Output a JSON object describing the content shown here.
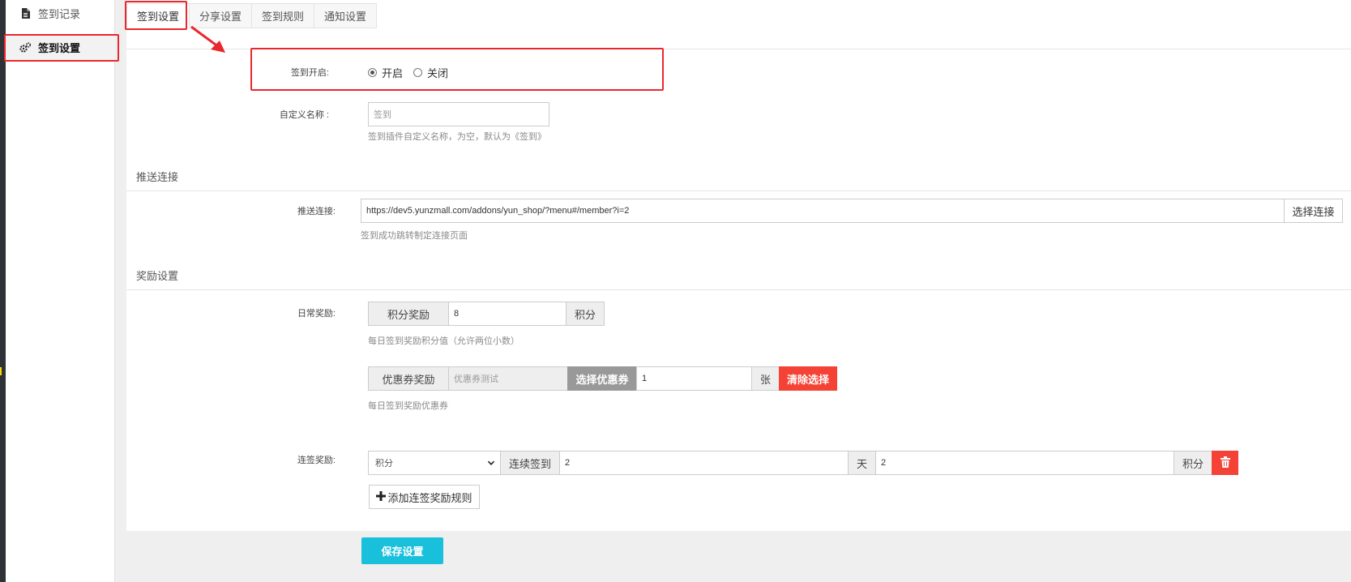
{
  "sidebar": {
    "items": [
      {
        "label": "签到记录",
        "icon": "document-icon",
        "active": false
      },
      {
        "label": "签到设置",
        "icon": "gears-icon",
        "active": true
      }
    ]
  },
  "tabs": [
    {
      "label": "签到设置",
      "active": true
    },
    {
      "label": "分享设置",
      "active": false
    },
    {
      "label": "签到规则",
      "active": false
    },
    {
      "label": "通知设置",
      "active": false
    }
  ],
  "sign_on": {
    "label": "签到开启:",
    "options": [
      {
        "label": "开启",
        "checked": true
      },
      {
        "label": "关闭",
        "checked": false
      }
    ]
  },
  "custom_name": {
    "label": "自定义名称 :",
    "placeholder": "签到",
    "hint": "签到插件自定义名称，为空，默认为《签到》"
  },
  "push_section": {
    "title": "推送连接",
    "label": "推送连接:",
    "value": "https://dev5.yunzmall.com/addons/yun_shop/?menu#/member?i=2",
    "select_button": "选择连接",
    "hint": "签到成功跳转制定连接页面"
  },
  "reward_section": {
    "title": "奖励设置",
    "daily": {
      "label": "日常奖励:",
      "points_addon": "积分奖励",
      "points_value": "8",
      "points_unit": "积分",
      "points_hint": "每日签到奖励积分值（允许两位小数）",
      "coupon_addon": "优惠券奖励",
      "coupon_name": "优惠券测试",
      "coupon_select": "选择优惠券",
      "coupon_qty": "1",
      "coupon_unit": "张",
      "coupon_clear": "清除选择",
      "coupon_hint": "每日签到奖励优惠券"
    },
    "continuous": {
      "label": "连签奖励:",
      "type_selected": "积分",
      "days_addon": "连续签到",
      "days_value": "2",
      "days_unit": "天",
      "points_value": "2",
      "points_unit": "积分",
      "delete_icon": "trash-icon",
      "add_rule": "添加连签奖励规则"
    }
  },
  "save_button": "保存设置",
  "colors": {
    "accent_red": "#f44336",
    "save_cyan": "#18c0db",
    "annotation_red": "#e8282c"
  }
}
